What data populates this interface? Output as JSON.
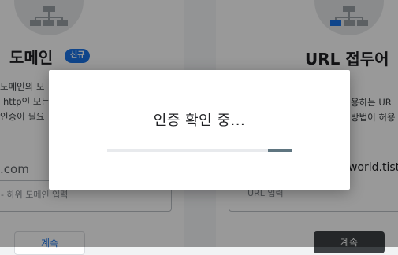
{
  "domain_card": {
    "title": "도메인",
    "badge": "신규",
    "description": [
      "도메인의 모",
      "http인 모든",
      "인증이 필요"
    ],
    "value": ".com",
    "input_placeholder": "- 하위 도메인 입력",
    "button": "계속"
  },
  "url_card": {
    "title": "URL 접두어",
    "description": [
      "용하는 UR",
      "방법이 허용"
    ],
    "value": "world.tist",
    "input_placeholder": "URL 입력",
    "button": "계속"
  },
  "dialog": {
    "message": "인증 확인 중...",
    "progress": 0.13
  },
  "colors": {
    "accent": "#1a73e8",
    "progress_fill": "#5f7580",
    "overlay": "rgba(0,0,0,0.40)",
    "dark_button": "#3c4043"
  }
}
